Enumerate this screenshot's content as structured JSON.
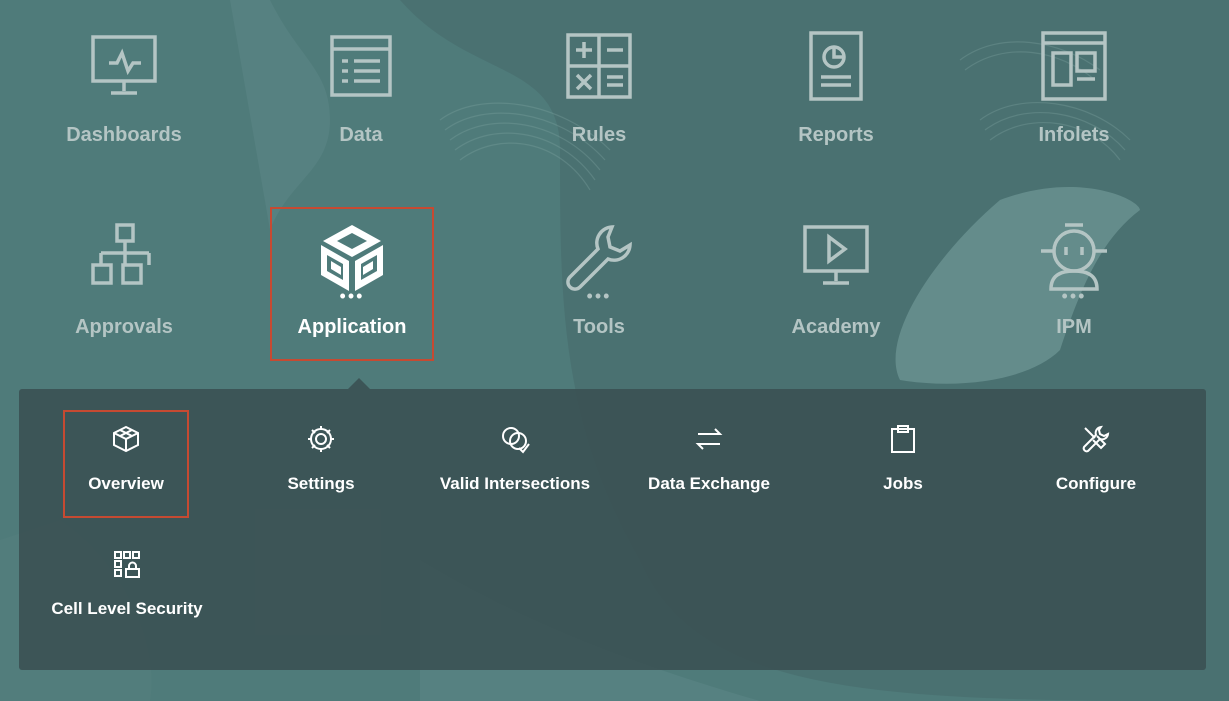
{
  "colors": {
    "background": "#4f7b7a",
    "panel": "#3a5052",
    "highlight_border": "#c64a32",
    "dim_text": "#b4c5c4",
    "active_text": "#ffffff"
  },
  "cards": [
    {
      "label": "Dashboards",
      "icon": "monitor-pulse-icon",
      "has_menu": false
    },
    {
      "label": "Data",
      "icon": "data-form-icon",
      "has_menu": false
    },
    {
      "label": "Rules",
      "icon": "calculator-icon",
      "has_menu": false
    },
    {
      "label": "Reports",
      "icon": "report-icon",
      "has_menu": false
    },
    {
      "label": "Infolets",
      "icon": "infolets-icon",
      "has_menu": false
    },
    {
      "label": "Approvals",
      "icon": "hierarchy-icon",
      "has_menu": false
    },
    {
      "label": "Application",
      "icon": "application-cube-icon",
      "has_menu": true,
      "dots": "•••"
    },
    {
      "label": "Tools",
      "icon": "wrench-icon",
      "has_menu": true,
      "dots": "•••"
    },
    {
      "label": "Academy",
      "icon": "play-screen-icon",
      "has_menu": false
    },
    {
      "label": "IPM",
      "icon": "robot-icon",
      "has_menu": true,
      "dots": "•••"
    }
  ],
  "submenu": [
    {
      "label": "Overview",
      "icon": "cube-icon"
    },
    {
      "label": "Settings",
      "icon": "gear-icon"
    },
    {
      "label": "Valid Intersections",
      "icon": "intersections-icon"
    },
    {
      "label": "Data Exchange",
      "icon": "exchange-arrows-icon"
    },
    {
      "label": "Jobs",
      "icon": "clipboard-icon"
    },
    {
      "label": "Configure",
      "icon": "tools-icon"
    },
    {
      "label": "Cell Level Security",
      "icon": "cell-security-icon"
    }
  ]
}
